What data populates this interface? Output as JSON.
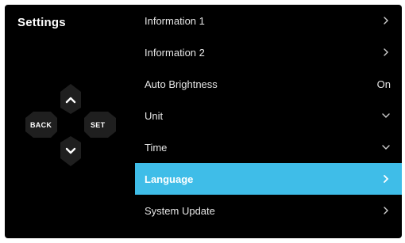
{
  "screen": {
    "title": "Settings"
  },
  "dpad": {
    "back_label": "BACK",
    "set_label": "SET"
  },
  "menu": {
    "items": [
      {
        "label": "Information 1",
        "value": "",
        "icon": "chevron-right-icon"
      },
      {
        "label": "Information 2",
        "value": "",
        "icon": "chevron-right-icon"
      },
      {
        "label": "Auto Brightness",
        "value": "On",
        "icon": ""
      },
      {
        "label": "Unit",
        "value": "",
        "icon": "chevron-down-icon"
      },
      {
        "label": "Time",
        "value": "",
        "icon": "chevron-down-icon"
      },
      {
        "label": "Language",
        "value": "",
        "icon": "chevron-right-icon",
        "selected": true
      },
      {
        "label": "System Update",
        "value": "",
        "icon": "chevron-right-icon"
      }
    ]
  },
  "colors": {
    "background": "#000000",
    "highlight": "#3fbde8",
    "text": "#e6e6e6",
    "button": "#1e1e1e"
  }
}
